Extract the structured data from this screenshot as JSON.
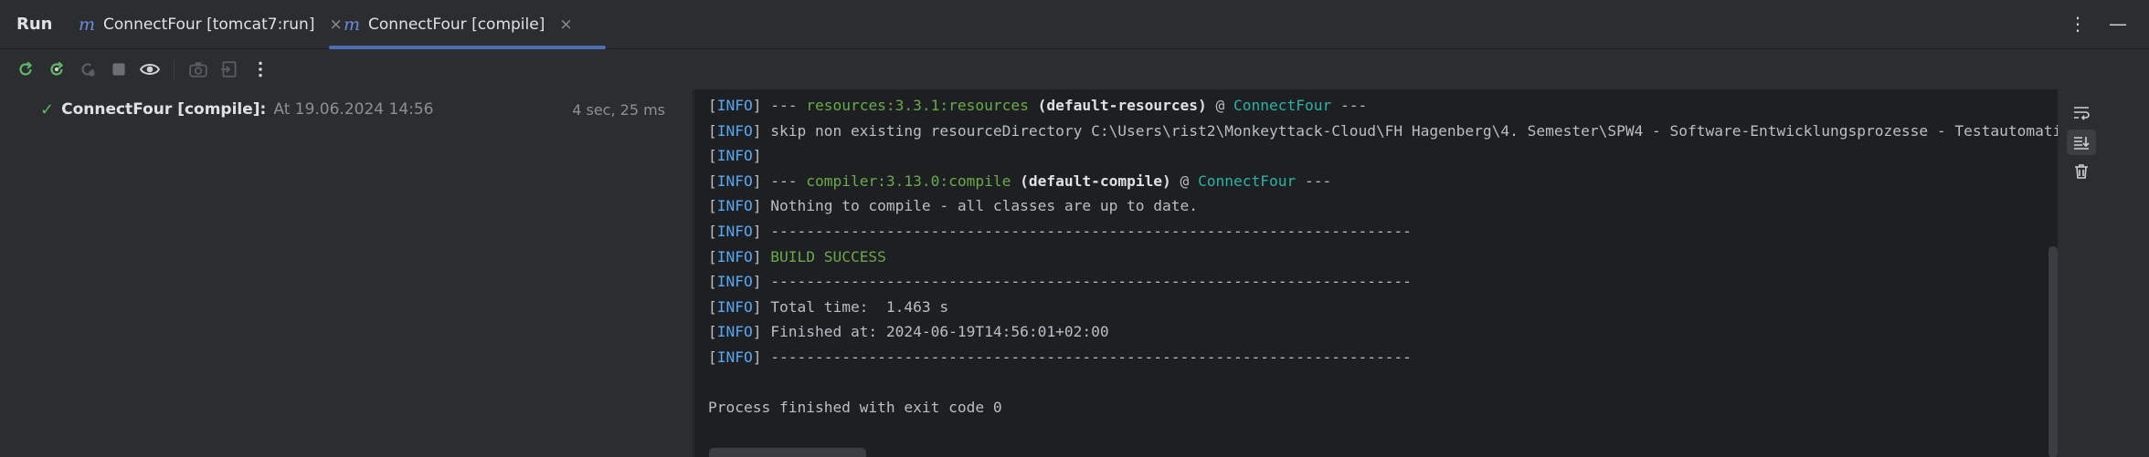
{
  "header": {
    "title": "Run",
    "tabs": [
      {
        "prefix": "m",
        "label": "ConnectFour [tomcat7:run]",
        "close": "×"
      },
      {
        "prefix": "m",
        "label": "ConnectFour [compile]",
        "close": "×"
      }
    ],
    "more_glyph": "⋮",
    "minimize_glyph": "—"
  },
  "toolbar": {
    "icons": [
      "rerun-icon",
      "rerun-failed-icon",
      "rerun-disabled-icon",
      "stop-icon",
      "eye-icon",
      "camera-icon",
      "export-icon",
      "more-icon"
    ]
  },
  "run_tree": {
    "item": {
      "check": "✓",
      "name": "ConnectFour [compile]:",
      "timestamp": "At 19.06.2024 14:56",
      "duration": "4 sec, 25 ms"
    }
  },
  "console": {
    "level": "INFO",
    "lines": {
      "l1": {
        "dash_pre": " --- ",
        "plugin": "resources:3.3.1:resources",
        "exec": "(default-resources)",
        "at": " @ ",
        "project": "ConnectFour",
        "dash_post": " ---"
      },
      "l2": {
        "text": " skip non existing resourceDirectory C:\\Users\\rist2\\Monkeyttack-Cloud\\FH Hagenberg\\4. Semester\\SPW4 - Software-Entwicklungsprozesse - Testautomatisierung"
      },
      "l4": {
        "dash_pre": " --- ",
        "plugin": "compiler:3.13.0:compile",
        "exec": "(default-compile)",
        "at": " @ ",
        "project": "ConnectFour",
        "dash_post": " ---"
      },
      "l5": {
        "text": " Nothing to compile - all classes are up to date."
      },
      "sep": " ------------------------------------------------------------------------",
      "l7": {
        "text": "BUILD SUCCESS"
      },
      "l9": {
        "text": " Total time:  1.463 s"
      },
      "l10": {
        "text": " Finished at: 2024-06-19T14:56:01+02:00"
      },
      "exit": "Process finished with exit code 0"
    }
  }
}
